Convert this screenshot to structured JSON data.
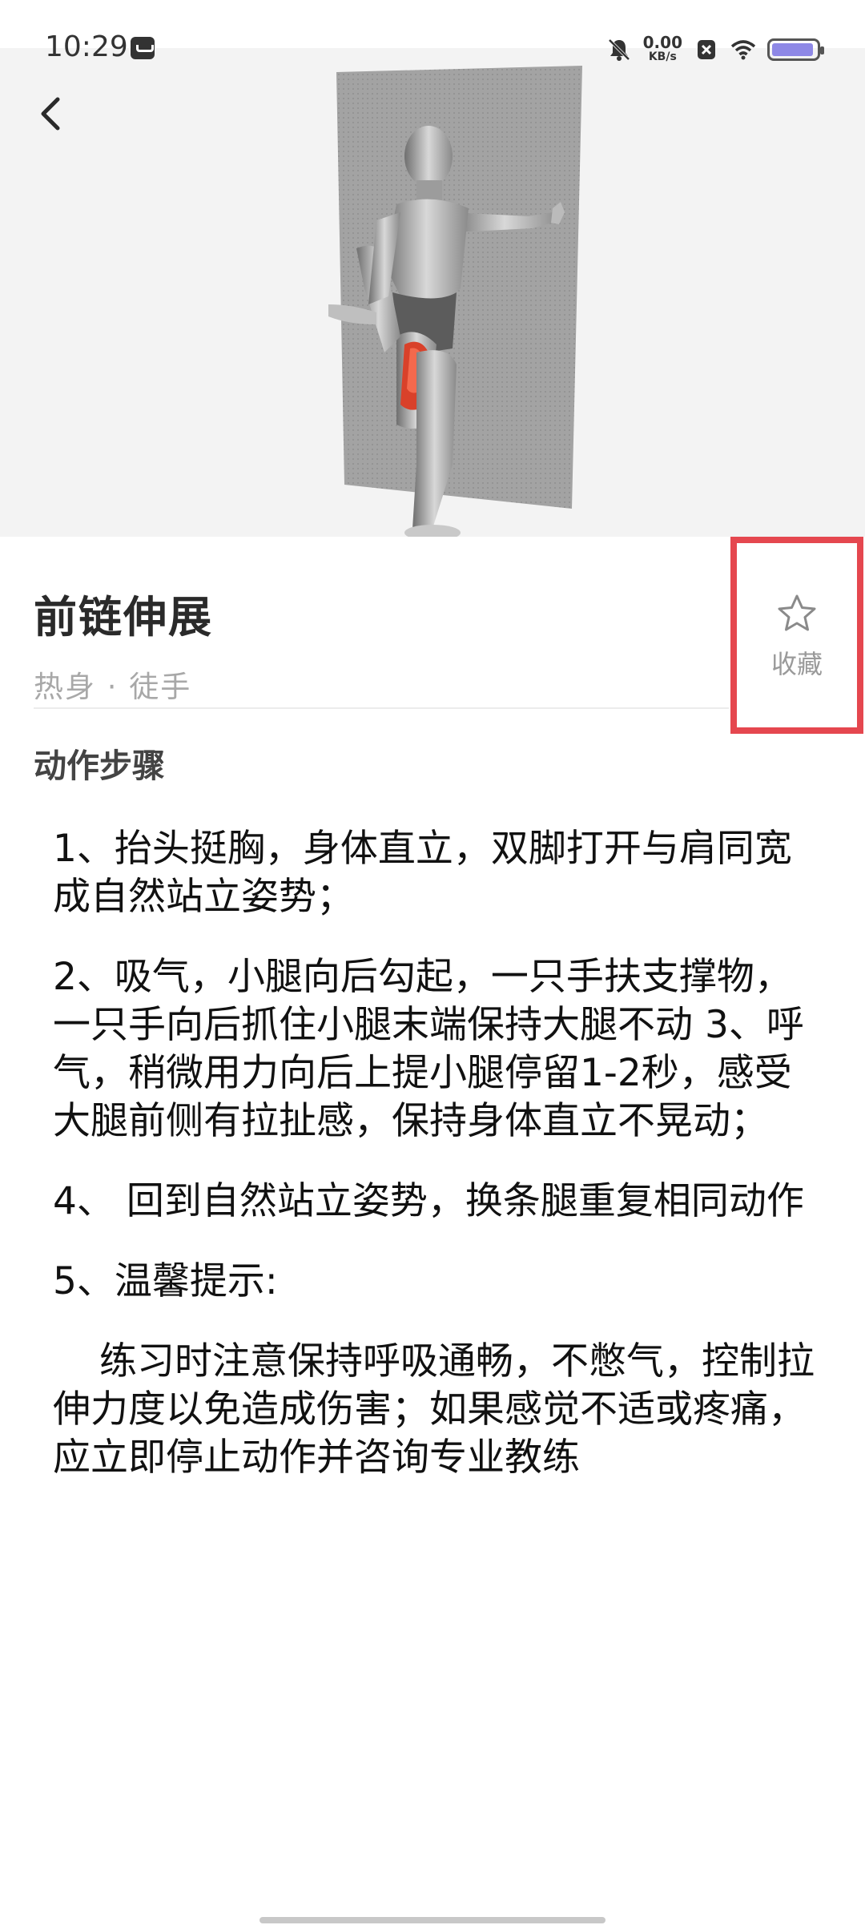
{
  "status_bar": {
    "time": "10:29",
    "net_speed_value": "0.00",
    "net_speed_unit": "KB/s",
    "battery_level": 0.95,
    "battery_color": "#8e88e6"
  },
  "hero": {
    "alt_icon": "exercise-illustration"
  },
  "exercise": {
    "title": "前链伸展",
    "tags": "热身 · 徒手"
  },
  "favorite": {
    "label": "收藏",
    "icon": "star-outline-icon",
    "highlight_color": "#e5474f"
  },
  "section": {
    "heading": "动作步骤"
  },
  "steps": [
    "1、抬头挺胸，身体直立，双脚打开与肩同宽成自然站立姿势；",
    "2、吸气，小腿向后勾起，一只手扶支撑物，一只手向后抓住小腿末端保持大腿不动 3、呼气，稍微用力向后上提小腿停留1-2秒，感受大腿前侧有拉扯感，保持身体直立不晃动；",
    "4、 回到自然站立姿势，换条腿重复相同动作",
    "5、温馨提示:",
    "练习时注意保持呼吸通畅，不憋气，控制拉伸力度以免造成伤害；如果感觉不适或疼痛，应立即停止动作并咨询专业教练"
  ]
}
